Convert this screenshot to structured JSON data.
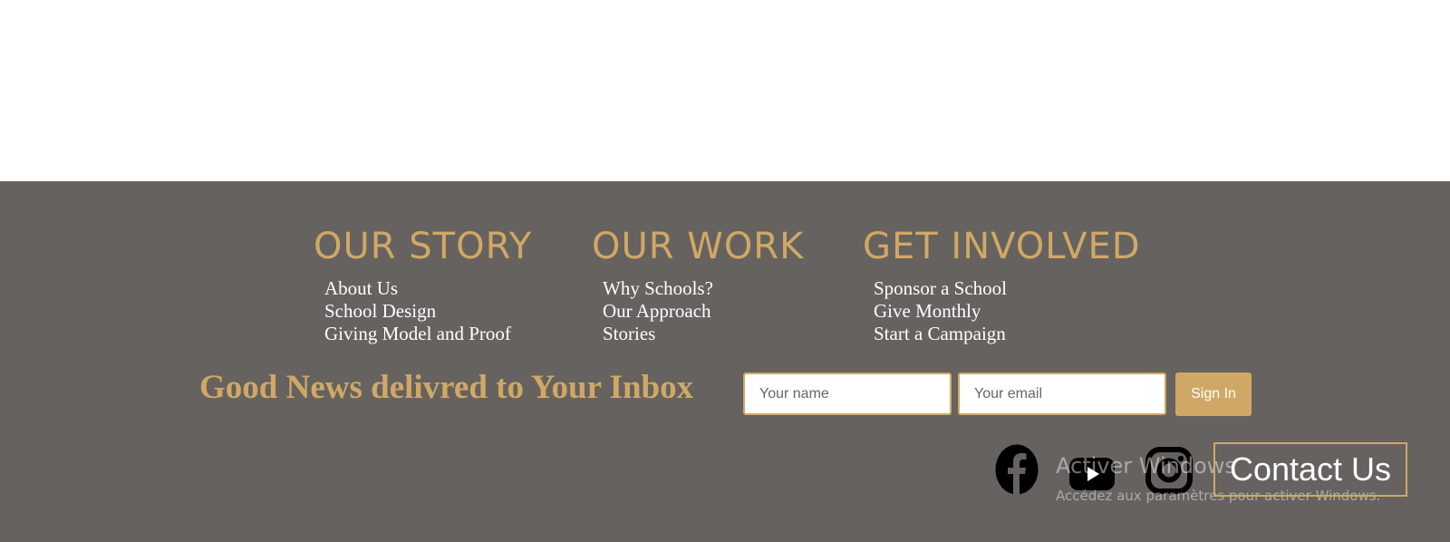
{
  "columns": [
    {
      "heading": "OUR STORY",
      "links": [
        "About Us",
        "School Design",
        "Giving Model and Proof"
      ]
    },
    {
      "heading": "OUR WORK",
      "links": [
        "Why Schools?",
        "Our Approach",
        "Stories"
      ]
    },
    {
      "heading": "GET INVOLVED",
      "links": [
        "Sponsor a School",
        "Give Monthly",
        "Start a Campaign"
      ]
    }
  ],
  "newsletter": {
    "title": "Good News delivred to Your Inbox",
    "name_placeholder": "Your name",
    "email_placeholder": "Your email",
    "submit_label": "Sign In"
  },
  "social": {
    "icons": [
      "facebook-icon",
      "youtube-icon",
      "instagram-icon"
    ]
  },
  "contact": {
    "label": "Contact Us"
  },
  "watermark": {
    "title": "Activer Windows",
    "subtitle": "Accédez aux paramètres pour activer Windows."
  },
  "colors": {
    "footer_bg": "#66625f",
    "accent_gold": "#d0a865",
    "link_text": "#ffffff",
    "icon": "#000000"
  }
}
